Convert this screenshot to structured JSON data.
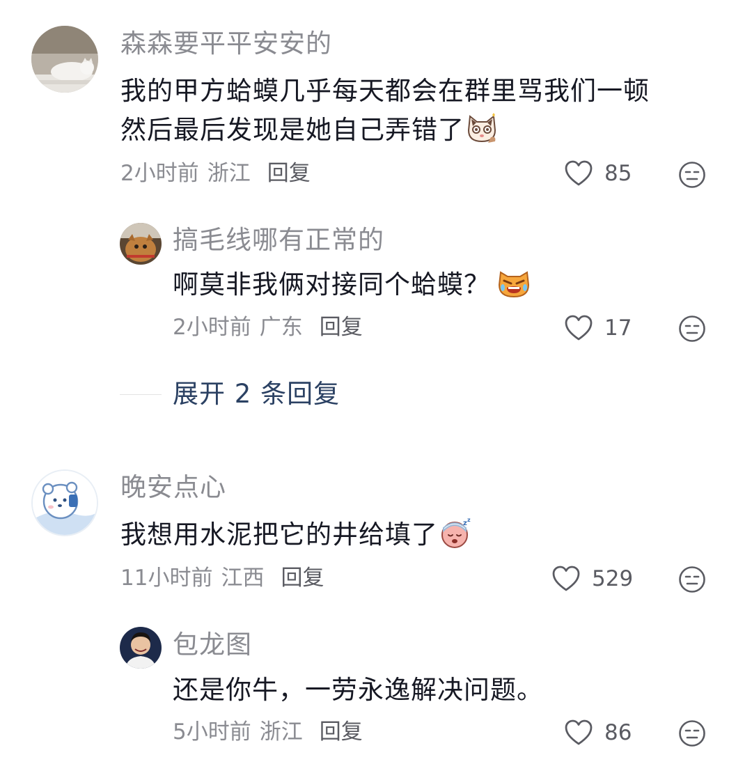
{
  "comments": [
    {
      "user": "森森要平平安安的",
      "avatar_icon": "cat-photo-avatar",
      "lines": [
        "我的甲方蛤蟆几乎每天都会在群里骂我们一顿",
        "然后最后发现是她自己弄错了"
      ],
      "emoji_icon": "shocked-cat-emoji",
      "time": "2小时前",
      "location": "浙江",
      "reply_label": "回复",
      "likes": "85"
    },
    {
      "user": "搞毛线哪有正常的",
      "avatar_icon": "cat-photo-avatar",
      "lines": [
        "啊莫非我俩对接同个蛤蟆？"
      ],
      "emoji_icon": "angry-crying-cat-emoji",
      "time": "2小时前",
      "location": "广东",
      "reply_label": "回复",
      "likes": "17"
    },
    {
      "user": "晚安点心",
      "avatar_icon": "bear-drawing-avatar",
      "lines": [
        "我想用水泥把它的井给填了"
      ],
      "emoji_icon": "sleepy-face-emoji",
      "time": "11小时前",
      "location": "江西",
      "reply_label": "回复",
      "likes": "529"
    },
    {
      "user": "包龙图",
      "avatar_icon": "person-photo-avatar",
      "lines": [
        "还是你牛，一劳永逸解决问题。"
      ],
      "time": "5小时前",
      "location": "浙江",
      "reply_label": "回复",
      "likes": "86"
    }
  ],
  "expand_replies": "展开 2 条回复",
  "colors": {
    "name": "#8a8b91",
    "text": "#161823",
    "link": "#2b4163"
  }
}
